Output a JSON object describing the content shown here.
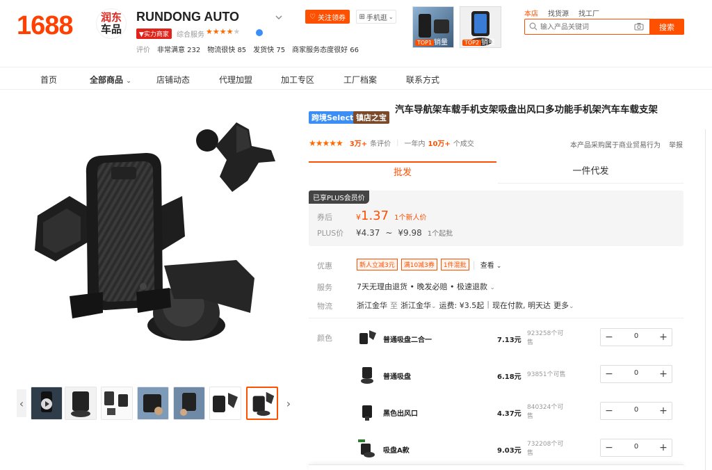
{
  "header": {
    "site_logo": "1688",
    "brand_logo": {
      "line1": "润东",
      "line2": "车品"
    },
    "shop_name": "RUNDONG AUTO",
    "badge": "实力商家",
    "score_label": "综合服务",
    "eval": {
      "label": "评价",
      "items": [
        "非常满意 232",
        "物流很快 85",
        "发货快 75",
        "商家服务态度很好 66"
      ]
    },
    "follow_button": "关注领券",
    "mobile_button": "手机逛",
    "top_products": [
      {
        "tag": "TOP1",
        "label": "销量"
      },
      {
        "tag": "TOP2",
        "label": "销量"
      }
    ],
    "search_scopes": [
      "本店",
      "找货源",
      "找工厂"
    ],
    "search_placeholder": "输入产品关键词",
    "search_button": "搜索"
  },
  "nav": {
    "items": [
      "首页",
      "全部商品",
      "店铺动态",
      "代理加盟",
      "加工专区",
      "工厂档案",
      "联系方式"
    ],
    "active": "全部商品"
  },
  "product": {
    "tags": [
      "跨境Select",
      "镇店之宝"
    ],
    "title": "汽车导航架车载手机支架吸盘出风口多功能手机架汽车车载支架",
    "rating": {
      "reviews": "3万+",
      "reviews_suffix": "条评价",
      "period": "一年内",
      "sales": "10万+",
      "sales_suffix": "个成交"
    },
    "legal_note": "本产品采购属于商业贸易行为",
    "report": "举报",
    "tabs": [
      "批发",
      "一件代发"
    ],
    "plus_tag": "已享PLUS会员价",
    "price_after_coupon": {
      "label": "券后",
      "currency": "¥",
      "value": "1.37",
      "note": "1个新人价"
    },
    "plus_price": {
      "label": "PLUS价",
      "low": "¥4.37",
      "sep": "~",
      "high": "¥9.98",
      "note": "1个起批"
    },
    "promo": {
      "label": "优惠",
      "coupons": [
        "新人立减3元",
        "满10减3券",
        "1件混批"
      ],
      "more": "查看"
    },
    "service": {
      "label": "服务",
      "text": "7天无理由退货 • 晚发必赔 • 极速退款"
    },
    "logistics": {
      "label": "物流",
      "from": "浙江金华",
      "to_word": "至",
      "to": "浙江金华",
      "fee": "运费: ¥3.5起",
      "sep": "|",
      "delivery": "现在付款, 明天达",
      "more": "更多"
    },
    "color_label": "颜色",
    "variants": [
      {
        "name": "普通吸盘二合一",
        "price": "7.13元",
        "stock": "923258个可售",
        "qty": "0"
      },
      {
        "name": "普通吸盘",
        "price": "6.18元",
        "stock": "93851个可售",
        "qty": "0"
      },
      {
        "name": "黑色出风口",
        "price": "4.37元",
        "stock": "840324个可售",
        "qty": "0"
      },
      {
        "name": "吸盘A款",
        "price": "9.03元",
        "stock": "732208个可售",
        "qty": "0"
      }
    ]
  },
  "colors": {
    "brand": "#ff5000",
    "select_tag": "#3a8ef6",
    "shop_tag": "#7a4a2a"
  }
}
